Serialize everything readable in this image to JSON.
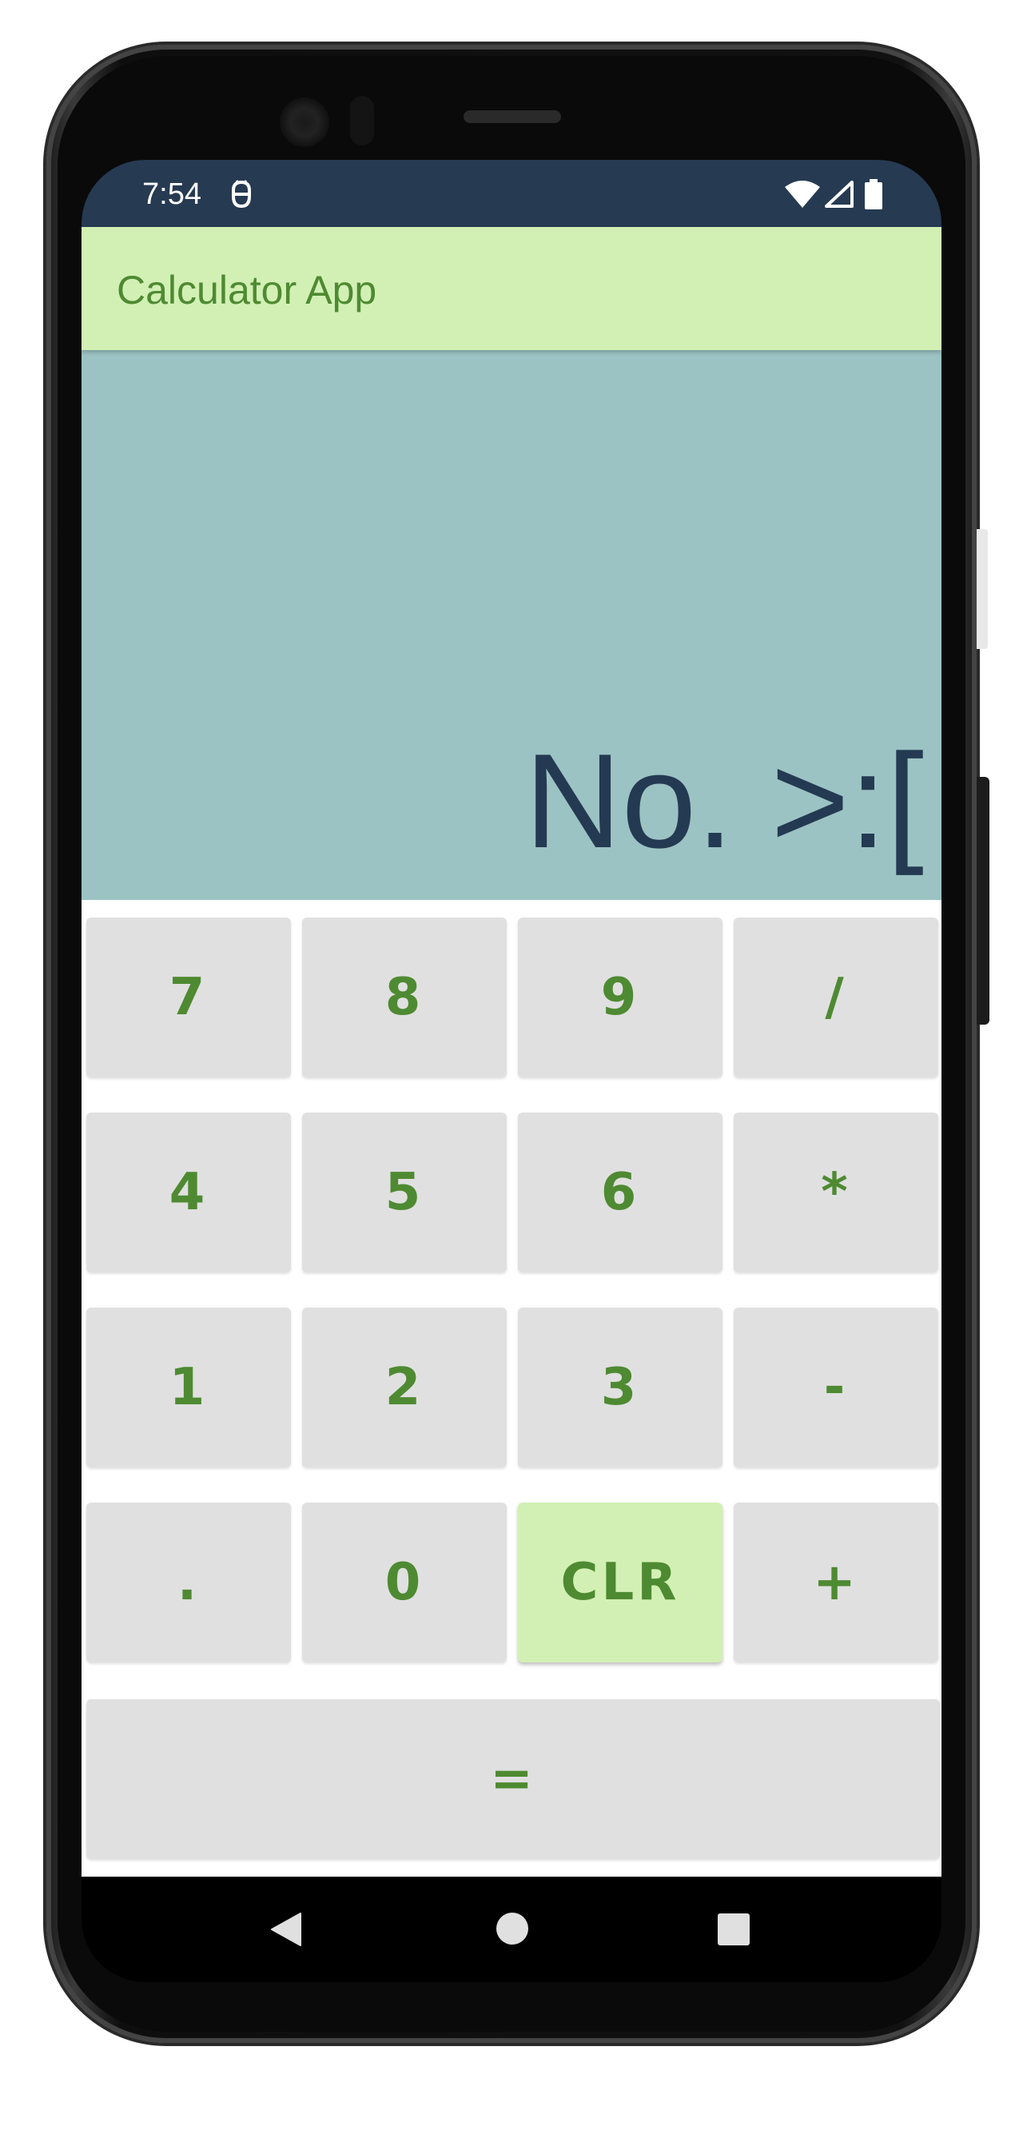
{
  "status_bar": {
    "time": "7:54",
    "icons": [
      "debug-icon",
      "wifi-icon",
      "cell-signal-icon",
      "battery-icon"
    ]
  },
  "app_bar": {
    "title": "Calculator App"
  },
  "display": {
    "text": "No. >:["
  },
  "keypad": {
    "rows": [
      [
        "7",
        "8",
        "9",
        "/"
      ],
      [
        "4",
        "5",
        "6",
        "*"
      ],
      [
        "1",
        "2",
        "3",
        "-"
      ],
      [
        ".",
        "0",
        "CLR",
        "+"
      ]
    ],
    "equals": "="
  },
  "nav_bar": {
    "icons": [
      "back-icon",
      "home-icon",
      "recents-icon"
    ]
  },
  "colors": {
    "status_bar": "#263a52",
    "app_bar": "#d2f0b4",
    "title_text": "#4e8a32",
    "display_bg": "#9cc3c3",
    "display_text": "#243a52",
    "key_bg": "#e0e0e0",
    "key_text": "#4e8a32",
    "clear_key_bg": "#d2f0b4"
  }
}
